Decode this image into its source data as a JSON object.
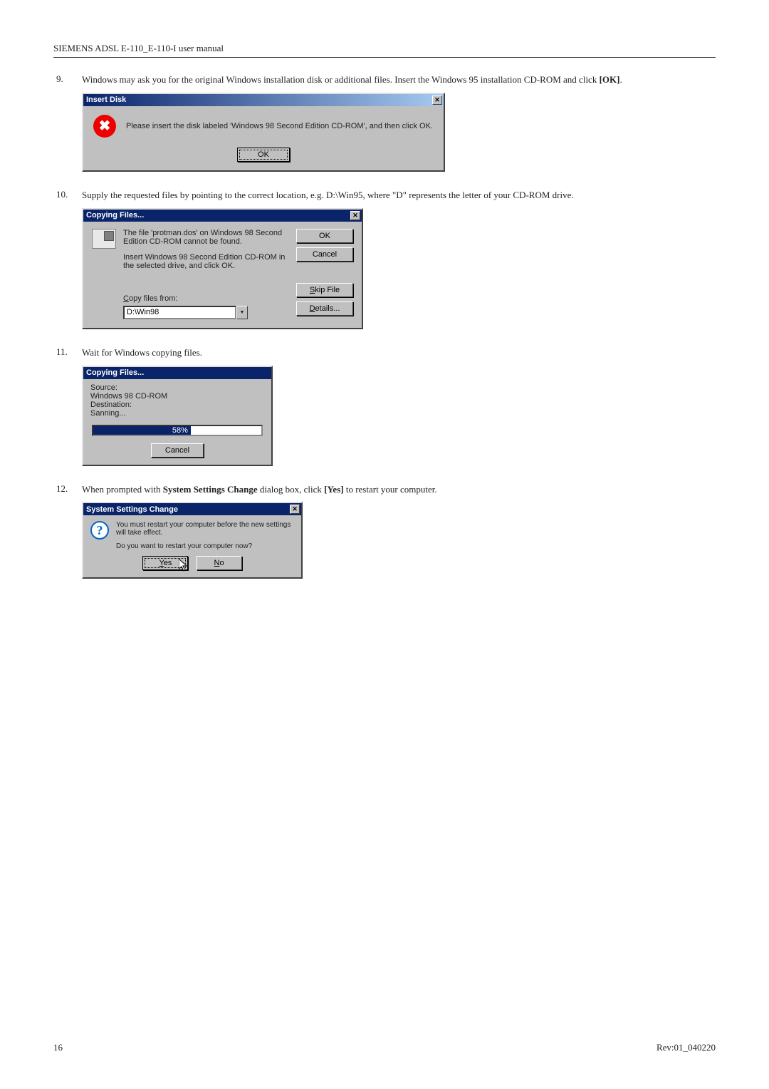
{
  "header": {
    "title": "SIEMENS ADSL E-110_E-110-I user manual"
  },
  "steps": {
    "s9": {
      "num": "9.",
      "text_a": "Windows may ask you for the original Windows installation disk or additional files. Insert the Windows 95 installation CD-ROM and click ",
      "text_b": "[OK]",
      "text_c": "."
    },
    "s10": {
      "num": "10.",
      "text": "Supply the requested files by pointing to the correct location, e.g. D:\\Win95, where \"D\" represents the letter of your CD-ROM drive."
    },
    "s11": {
      "num": "11.",
      "text": "Wait for Windows copying files."
    },
    "s12": {
      "num": "12.",
      "text_a": "When prompted with ",
      "text_b": "System Settings Change",
      "text_c": " dialog box, click ",
      "text_d": "[Yes]",
      "text_e": " to restart your computer."
    }
  },
  "dlg_insert": {
    "title": "Insert Disk",
    "close": "✕",
    "msg": "Please insert the disk labeled 'Windows 98 Second Edition CD-ROM', and then click OK.",
    "ok": "OK"
  },
  "dlg_copy1": {
    "title": "Copying Files...",
    "close": "✕",
    "p1": "The file 'protman.dos' on Windows 98 Second Edition CD-ROM cannot be found.",
    "p2": "Insert Windows 98 Second Edition CD-ROM in the selected drive, and click OK.",
    "label_copy": "Copy files from:",
    "path": "D:\\Win98",
    "btn_ok": "OK",
    "btn_cancel": "Cancel",
    "btn_skip": "Skip File",
    "btn_details": "Details..."
  },
  "dlg_copy2": {
    "title": "Copying Files...",
    "l1": "Source:",
    "l2": "Windows 98 CD-ROM",
    "l3": "Destination:",
    "l4": "Sanning...",
    "pct": "58%",
    "cancel": "Cancel"
  },
  "dlg_sys": {
    "title": "System Settings Change",
    "close": "✕",
    "p1": "You must restart your computer before the new settings will take effect.",
    "p2": "Do you want to restart your computer now?",
    "yes": "Yes",
    "no": "No"
  },
  "footer": {
    "page": "16",
    "rev": "Rev:01_040220"
  }
}
